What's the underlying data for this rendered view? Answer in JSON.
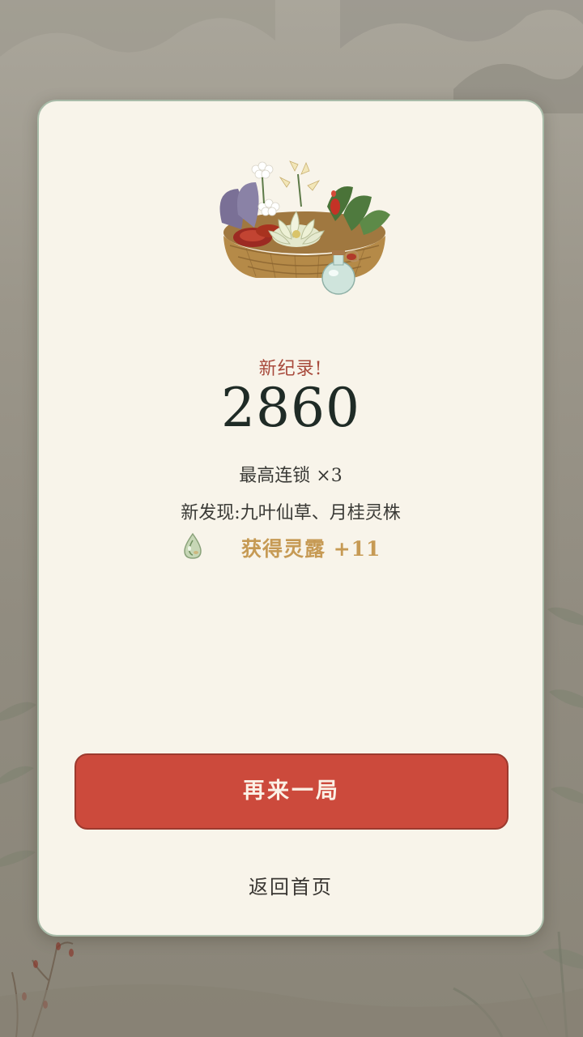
{
  "result": {
    "record_label": "新纪录!",
    "score": "2860",
    "combo_text": "最高连锁 ×3",
    "discovery_text": "新发现:九叶仙草、月桂灵株",
    "reward_text": "获得灵露 +11",
    "reward_icon": "dew-drop-icon"
  },
  "buttons": {
    "play_again": "再来一局",
    "back_home": "返回首页"
  },
  "colors": {
    "accent_red": "#cc4a3c",
    "reward_gold": "#c69a54",
    "record_red": "#a84a3c",
    "card_bg": "#f8f4ea"
  }
}
